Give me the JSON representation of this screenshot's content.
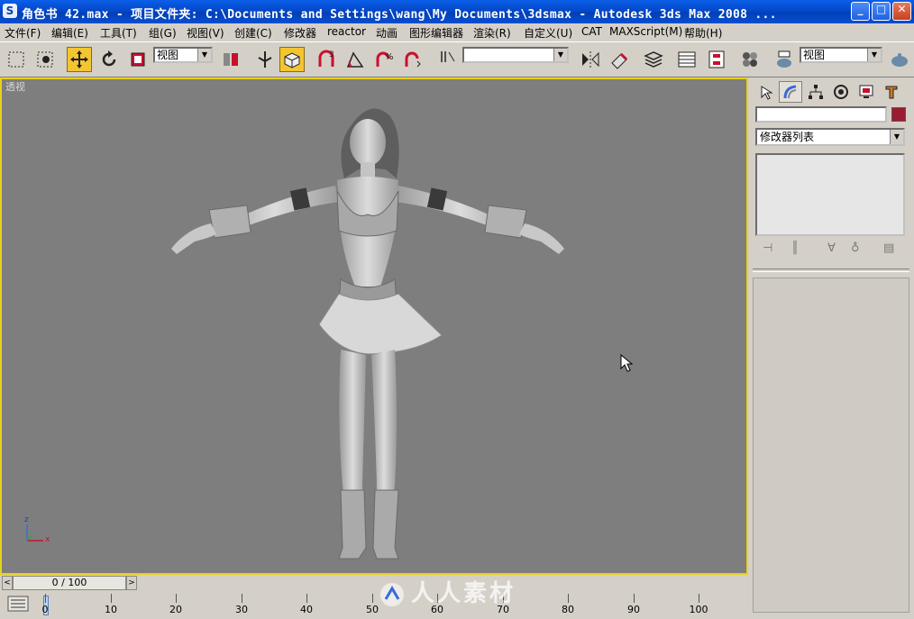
{
  "window": {
    "icon_letter": "S",
    "title": "角色书 42.max    - 项目文件夹: C:\\Documents and Settings\\wang\\My Documents\\3dsmax    - Autodesk 3ds Max 2008  ...",
    "minimize": "_",
    "maximize": "□",
    "close": "✕"
  },
  "menu": [
    "文件(F)",
    "编辑(E)",
    "工具(T)",
    "组(G)",
    "视图(V)",
    "创建(C)",
    "修改器",
    "reactor",
    "动画",
    "图形编辑器",
    "渲染(R)",
    "自定义(U)",
    "CAT",
    "MAXScript(M)",
    "帮助(H)"
  ],
  "toolbar": {
    "coord_system": "视图",
    "named_selection": "",
    "view_dropdown": "视图",
    "accent_color": "#f3c531"
  },
  "viewport": {
    "label": "透视",
    "border_color": "#e8d21c",
    "axis_x": "x",
    "axis_z": "z"
  },
  "command_panel": {
    "modifier_list": "修改器列表",
    "object_color": "#9b1b30"
  },
  "time_slider": {
    "frame_display": "0 / 100",
    "left_arrow": "<",
    "right_arrow": ">"
  },
  "trackbar": {
    "ticks": [
      "0",
      "10",
      "20",
      "30",
      "40",
      "50",
      "60",
      "70",
      "80",
      "90",
      "100"
    ]
  },
  "watermark": "人人素材"
}
